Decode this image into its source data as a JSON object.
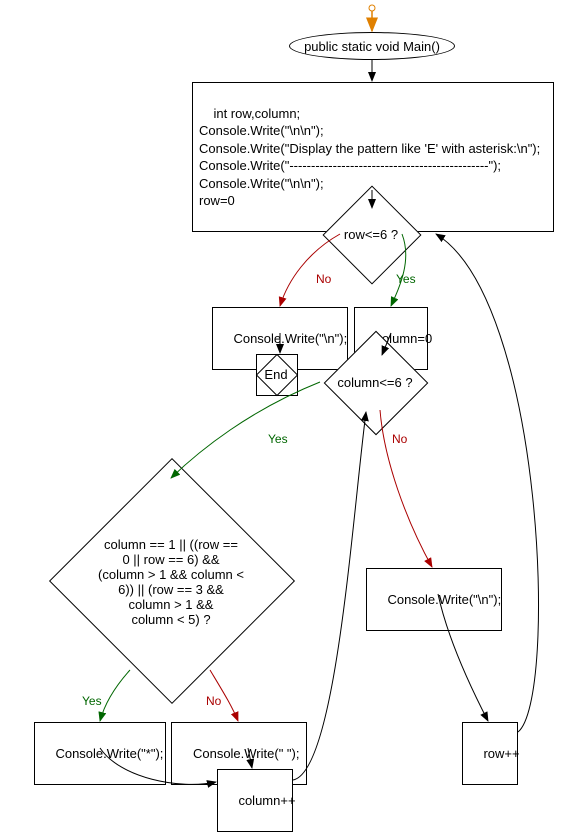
{
  "chart_data": {
    "type": "flowchart",
    "nodes": [
      {
        "id": "start",
        "shape": "ellipse",
        "label": "public static void Main()"
      },
      {
        "id": "init",
        "shape": "rect",
        "label": "int row,column;\nConsole.Write(\"\\n\\n\");\nConsole.Write(\"Display the pattern like 'E' with asterisk:\\n\");\nConsole.Write(\"----------------------------------------------\");\nConsole.Write(\"\\n\\n\");\nrow=0"
      },
      {
        "id": "d_row",
        "shape": "diamond",
        "label": "row<=6 ?"
      },
      {
        "id": "nl_final",
        "shape": "rect",
        "label": "Console.Write(\"\\n\");"
      },
      {
        "id": "set_col",
        "shape": "rect",
        "label": "column=0"
      },
      {
        "id": "end",
        "shape": "end",
        "label": "End"
      },
      {
        "id": "d_col",
        "shape": "diamond",
        "label": "column<=6 ?"
      },
      {
        "id": "d_cond",
        "shape": "diamond",
        "label": "column == 1 || ((row ==\n0 || row == 6) &&\n(column > 1 && column <\n6)) || (row == 3 &&\ncolumn > 1 &&\ncolumn < 5) ?"
      },
      {
        "id": "nl_row",
        "shape": "rect",
        "label": "Console.Write(\"\\n\");"
      },
      {
        "id": "w_star",
        "shape": "rect",
        "label": "Console.Write(\"*\");"
      },
      {
        "id": "w_space",
        "shape": "rect",
        "label": "Console.Write(\" \");"
      },
      {
        "id": "row_inc",
        "shape": "rect",
        "label": "row++"
      },
      {
        "id": "col_inc",
        "shape": "rect",
        "label": "column++"
      }
    ],
    "edges": [
      {
        "from": "entry",
        "to": "start",
        "color": "orange"
      },
      {
        "from": "start",
        "to": "init"
      },
      {
        "from": "init",
        "to": "d_row"
      },
      {
        "from": "d_row",
        "to": "nl_final",
        "label": "No"
      },
      {
        "from": "d_row",
        "to": "set_col",
        "label": "Yes"
      },
      {
        "from": "nl_final",
        "to": "end"
      },
      {
        "from": "set_col",
        "to": "d_col"
      },
      {
        "from": "d_col",
        "to": "d_cond",
        "label": "Yes"
      },
      {
        "from": "d_col",
        "to": "nl_row",
        "label": "No"
      },
      {
        "from": "d_cond",
        "to": "w_star",
        "label": "Yes"
      },
      {
        "from": "d_cond",
        "to": "w_space",
        "label": "No"
      },
      {
        "from": "w_star",
        "to": "col_inc"
      },
      {
        "from": "w_space",
        "to": "col_inc"
      },
      {
        "from": "col_inc",
        "to": "d_col"
      },
      {
        "from": "nl_row",
        "to": "row_inc"
      },
      {
        "from": "row_inc",
        "to": "d_row"
      }
    ],
    "edge_labels": {
      "yes": "Yes",
      "no": "No"
    }
  }
}
